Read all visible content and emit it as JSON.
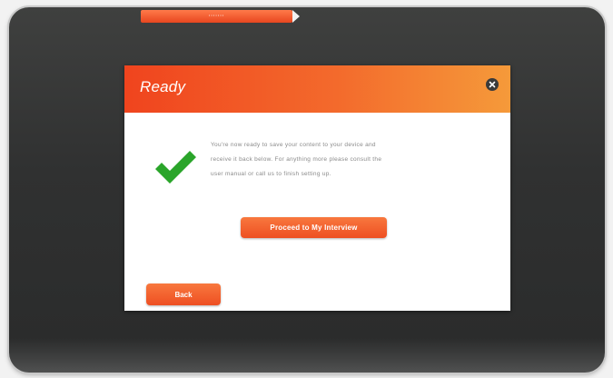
{
  "progress": {
    "label": "·······",
    "fraction": 1.0
  },
  "dialog": {
    "title": "Ready",
    "close_icon": "close-icon",
    "status_icon": "checkmark-icon",
    "message_lines": [
      "You're now ready to save your content to your device and",
      "receive it back below. For anything more please consult the",
      "user manual or call us to finish setting up."
    ],
    "primary_button_label": "Proceed to My Interview",
    "back_button_label": "Back"
  },
  "colors": {
    "accent": "#f0441e",
    "accent_light": "#f59a3a",
    "check": "#2aa52a",
    "bezel": "#333434"
  }
}
